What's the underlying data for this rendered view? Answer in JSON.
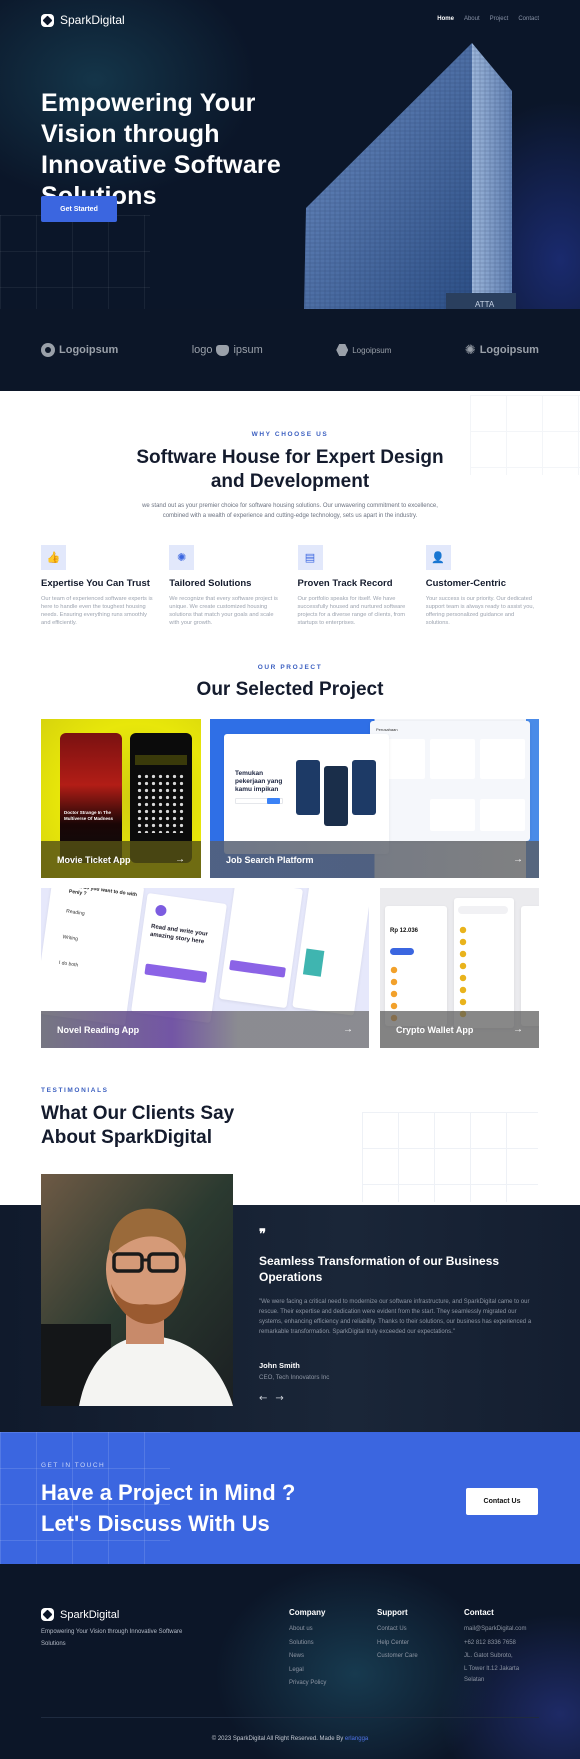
{
  "nav": {
    "brand": "SparkDigital",
    "links": [
      {
        "label": "Home",
        "active": true
      },
      {
        "label": "About",
        "active": false
      },
      {
        "label": "Project",
        "active": false
      },
      {
        "label": "Contact",
        "active": false
      }
    ]
  },
  "hero": {
    "title": "Empowering Your Vision through Innovative Software Solutions",
    "cta_label": "Get Started",
    "building_sign": "ATTA"
  },
  "logos": [
    {
      "name": "Logoipsum",
      "icon": "ring-logo-icon"
    },
    {
      "name": "logo ipsum",
      "icon": "bear-logo-icon"
    },
    {
      "name": "Logoipsum",
      "icon": "hexagon-logo-icon"
    },
    {
      "name": "Logoipsum",
      "icon": "sunburst-logo-icon"
    }
  ],
  "why": {
    "eyebrow": "WHY CHOOSE US",
    "title": "Software House for Expert Design and Development",
    "description": "we stand out as your premier choice for software housing solutions. Our unwavering commitment to excellence, combined with a wealth of experience and cutting-edge technology, sets us apart in the industry.",
    "features": [
      {
        "icon": "thumbs-up-icon",
        "glyph": "👍",
        "title": "Expertise You Can Trust",
        "description": "Our team of experienced software experts is here to handle even the toughest housing needs. Ensuring everything runs smoothly and efficiently."
      },
      {
        "icon": "gear-icon",
        "glyph": "✺",
        "title": "Tailored Solutions",
        "description": "We recognize that every software project is unique. We create customized housing solutions that match your goals and scale with your growth."
      },
      {
        "icon": "presentation-board-icon",
        "glyph": "▤",
        "title": "Proven Track Record",
        "description": "Our portfolio speaks for itself. We have successfully housed and nurtured software projects for a diverse range of clients, from startups to enterprises."
      },
      {
        "icon": "user-check-icon",
        "glyph": "👤",
        "title": "Customer-Centric",
        "description": "Your success is our priority. Our dedicated support team is always ready to assist you, offering personalized guidance and solutions."
      }
    ]
  },
  "projects": {
    "eyebrow": "OUR PROJECT",
    "title": "Our Selected Project",
    "items": [
      {
        "label": "Movie Ticket App",
        "arrow": "→",
        "accent": "#e6e40a",
        "preview_title": "Doctor Strange In The Multiverse Of Madness"
      },
      {
        "label": "Job Search Platform",
        "arrow": "→",
        "accent": "#3b7fe8",
        "preview_heading": "Temukan pekerjaan yang kamu impikan",
        "preview_section": "Perusahaan"
      },
      {
        "label": "Novel Reading App",
        "arrow": "→",
        "accent": "#8b63e6",
        "preview_heading": "Read and write your amazing story here",
        "preview_question": "What do you want to do with Penly ?",
        "preview_options": [
          "Reading",
          "Writing",
          "I do both"
        ]
      },
      {
        "label": "Crypto Wallet App",
        "arrow": "→",
        "accent": "#3b66e0",
        "preview_balance": "Rp 12.036"
      }
    ]
  },
  "testimonials": {
    "eyebrow": "TESTIMONIALS",
    "title": "What Our Clients Say About SparkDigital",
    "quote_mark": "❞",
    "headline": "Seamless Transformation of our Business Operations",
    "text": "\"We were facing a critical need to modernize our software infrastructure, and SparkDigital came to our rescue. Their expertise and dedication were evident from the start. They seamlessly migrated our systems, enhancing efficiency and reliability. Thanks to their solutions, our business has experienced a remarkable transformation. SparkDigital truly exceeded our expectations.\"",
    "author": "John Smith",
    "role": "CEO, Tech Innovators Inc",
    "prev": "←",
    "next": "→"
  },
  "cta": {
    "eyebrow": "GET IN TOUCH",
    "line1": "Have a Project in Mind ?",
    "line2": "Let's Discuss With Us",
    "button": "Contact Us"
  },
  "footer": {
    "brand": "SparkDigital",
    "tagline": "Empowering Your Vision through Innovative Software Solutions",
    "columns": [
      {
        "title": "Company",
        "links": [
          "About us",
          "Solutions",
          "News",
          "Legal",
          "Privacy Policy"
        ]
      },
      {
        "title": "Support",
        "links": [
          "Contact Us",
          "Help Center",
          "Customer Care"
        ]
      },
      {
        "title": "Contact",
        "links": [
          "mail@SparkDigital.com",
          "+62 812 8336 7658",
          "JL. Gatot Subroto,",
          "L Tower lt.12 Jakarta",
          "Selatan"
        ]
      }
    ],
    "copyright": "© 2023 SparkDigital All Right Reserved. Made By",
    "author_link": "erlangga"
  }
}
